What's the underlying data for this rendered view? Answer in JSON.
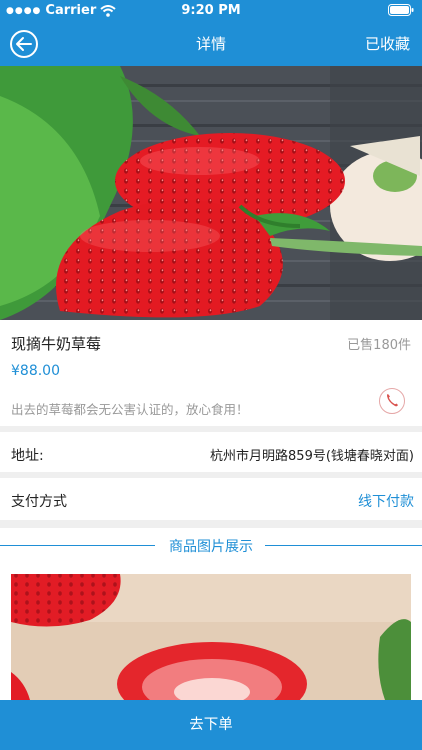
{
  "status_bar": {
    "carrier": "Carrier",
    "time": "9:20 PM"
  },
  "nav": {
    "title": "详情",
    "favorite_label": "已收藏"
  },
  "product": {
    "name": "现摘牛奶草莓",
    "sold": "已售180件",
    "price": "¥88.00",
    "description": "出去的草莓都会无公害认证的，放心食用！"
  },
  "address": {
    "label": "地址:",
    "value": "杭州市月明路859号(钱塘春晓对面)"
  },
  "payment": {
    "label": "支付方式",
    "value": "线下付款"
  },
  "gallery": {
    "title": "商品图片展示"
  },
  "actions": {
    "order_label": "去下单"
  },
  "icons": {
    "back": "back-arrow-icon",
    "phone": "phone-icon",
    "wifi": "wifi-icon",
    "battery": "battery-icon"
  },
  "colors": {
    "accent": "#1f8fd6",
    "phone": "#d9534f"
  }
}
